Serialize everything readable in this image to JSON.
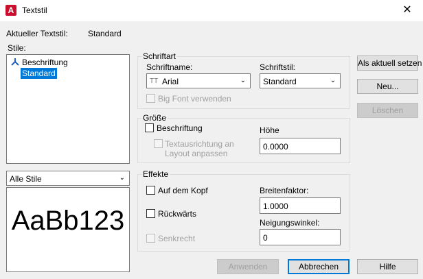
{
  "window": {
    "title": "Textstil",
    "close": "✕",
    "app_icon_letter": "A"
  },
  "current_style": {
    "label": "Aktueller Textstil:",
    "value": "Standard"
  },
  "styles": {
    "label": "Stile:",
    "items": [
      {
        "label": "Beschriftung",
        "icon": "annotative-icon"
      },
      {
        "label": "Standard",
        "selected": true
      }
    ],
    "filter": {
      "value": "Alle Stile"
    }
  },
  "preview": {
    "text": "AaBb123"
  },
  "font": {
    "group_title": "Schriftart",
    "name_label": "Schriftname:",
    "name_icon": "TT",
    "name_value": "Arial",
    "style_label": "Schriftstil:",
    "style_value": "Standard",
    "bigfont_label": "Big Font verwenden"
  },
  "size": {
    "group_title": "Größe",
    "annotative_label": "Beschriftung",
    "match_layout_label_1": "Textausrichtung an",
    "match_layout_label_2": "Layout anpassen",
    "height_label": "Höhe",
    "height_value": "0.0000"
  },
  "effects": {
    "group_title": "Effekte",
    "upside_down_label": "Auf dem Kopf",
    "backwards_label": "Rückwärts",
    "vertical_label": "Senkrecht",
    "width_factor_label": "Breitenfaktor:",
    "width_factor_value": "1.0000",
    "oblique_label": "Neigungswinkel:",
    "oblique_value": "0"
  },
  "buttons": {
    "set_current": "Als aktuell setzen",
    "new": "Neu...",
    "delete": "Löschen",
    "apply": "Anwenden",
    "cancel": "Abbrechen",
    "help": "Hilfe"
  },
  "colors": {
    "selection": "#0078d7",
    "app_icon": "#c8102e"
  }
}
